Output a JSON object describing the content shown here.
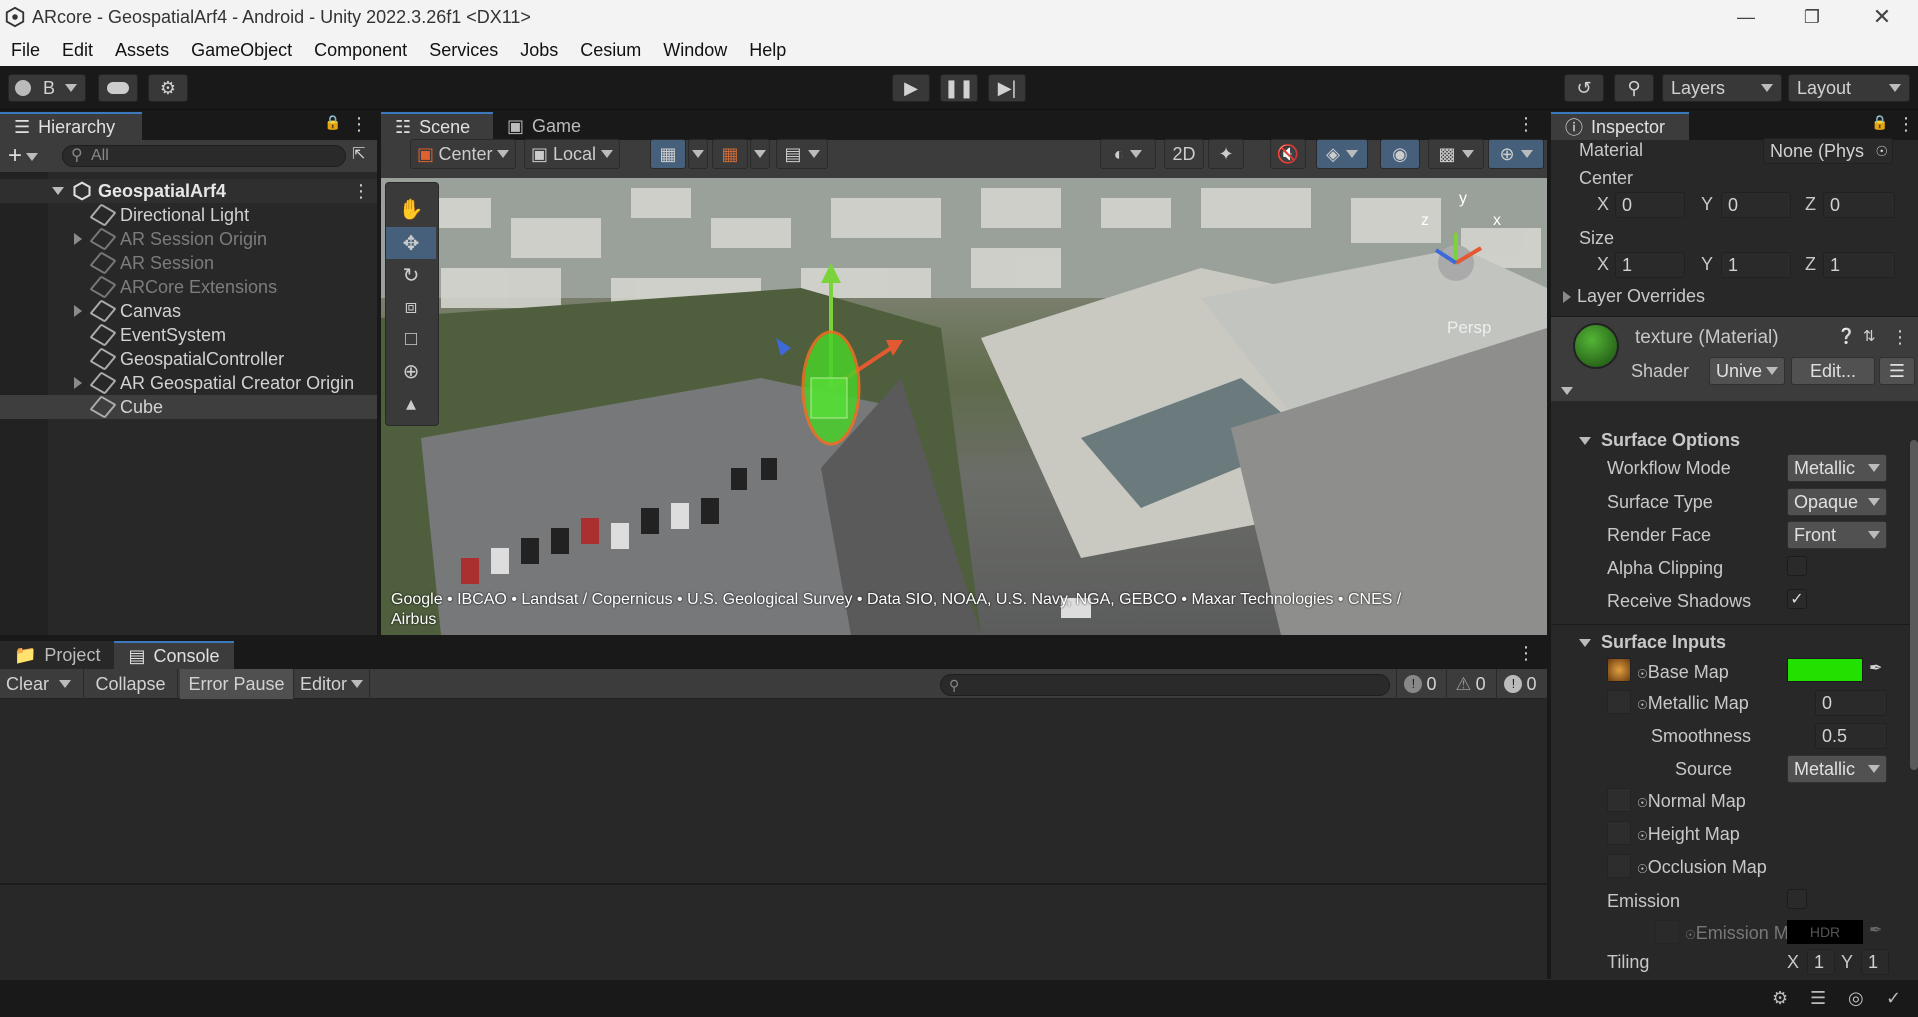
{
  "window": {
    "title": "ARcore - GeospatialArf4 - Android - Unity 2022.3.26f1 <DX11>"
  },
  "menu": [
    "File",
    "Edit",
    "Assets",
    "GameObject",
    "Component",
    "Services",
    "Jobs",
    "Cesium",
    "Window",
    "Help"
  ],
  "toolbar": {
    "account": "B",
    "layers": "Layers",
    "layout": "Layout"
  },
  "hierarchy": {
    "tab": "Hierarchy",
    "search_placeholder": "All",
    "scene": "GeospatialArf4",
    "items": [
      {
        "label": "Directional Light",
        "dim": false,
        "expandable": false
      },
      {
        "label": "AR Session Origin",
        "dim": true,
        "expandable": true
      },
      {
        "label": "AR Session",
        "dim": true,
        "expandable": false
      },
      {
        "label": "ARCore Extensions",
        "dim": true,
        "expandable": false
      },
      {
        "label": "Canvas",
        "dim": false,
        "expandable": true
      },
      {
        "label": "EventSystem",
        "dim": false,
        "expandable": false
      },
      {
        "label": "GeospatialController",
        "dim": false,
        "expandable": false
      },
      {
        "label": "AR Geospatial Creator Origin",
        "dim": false,
        "expandable": true
      },
      {
        "label": "Cube",
        "dim": false,
        "expandable": false
      }
    ]
  },
  "scene": {
    "tabs": [
      "Scene",
      "Game"
    ],
    "pivot": "Center",
    "space": "Local",
    "mode2d": "2D",
    "persp": "Persp",
    "attribution": "Google • IBCAO • Landsat / Copernicus • U.S. Geological Survey • Data SIO, NOAA, U.S. Navy, NGA, GEBCO • Maxar Technologies • CNES / Airbus",
    "gizmo": {
      "y": "y",
      "x": "x",
      "z": "z"
    }
  },
  "console": {
    "tabs": [
      "Project",
      "Console"
    ],
    "clear": "Clear",
    "collapse": "Collapse",
    "error_pause": "Error Pause",
    "editor": "Editor",
    "counts": {
      "log": "0",
      "warn": "0",
      "error": "0"
    }
  },
  "inspector": {
    "tab": "Inspector",
    "material_label": "Material",
    "material_value": "None (Phys",
    "center_label": "Center",
    "center": {
      "x": "0",
      "y": "0",
      "z": "0"
    },
    "size_label": "Size",
    "size": {
      "x": "1",
      "y": "1",
      "z": "1"
    },
    "layer_overrides": "Layer Overrides",
    "mat_name": "texture (Material)",
    "shader_label": "Shader",
    "shader_value": "Unive",
    "edit_btn": "Edit...",
    "surface_options": "Surface Options",
    "workflow_mode": {
      "label": "Workflow Mode",
      "value": "Metallic"
    },
    "surface_type": {
      "label": "Surface Type",
      "value": "Opaque"
    },
    "render_face": {
      "label": "Render Face",
      "value": "Front"
    },
    "alpha_clipping": {
      "label": "Alpha Clipping",
      "checked": false
    },
    "receive_shadows": {
      "label": "Receive Shadows",
      "checked": true
    },
    "surface_inputs": "Surface Inputs",
    "base_map": "Base Map",
    "base_color": "#22e000",
    "metallic_map": {
      "label": "Metallic Map",
      "value": "0"
    },
    "smoothness": {
      "label": "Smoothness",
      "value": "0.5"
    },
    "source": {
      "label": "Source",
      "value": "Metallic"
    },
    "normal_map": "Normal Map",
    "height_map": "Height Map",
    "occlusion_map": "Occlusion Map",
    "emission": "Emission",
    "emission_map": "Emission M",
    "hdr": "HDR",
    "tiling": {
      "label": "Tiling",
      "x": "1",
      "y": "1"
    }
  },
  "axis": {
    "x": "X",
    "y": "Y",
    "z": "Z"
  }
}
